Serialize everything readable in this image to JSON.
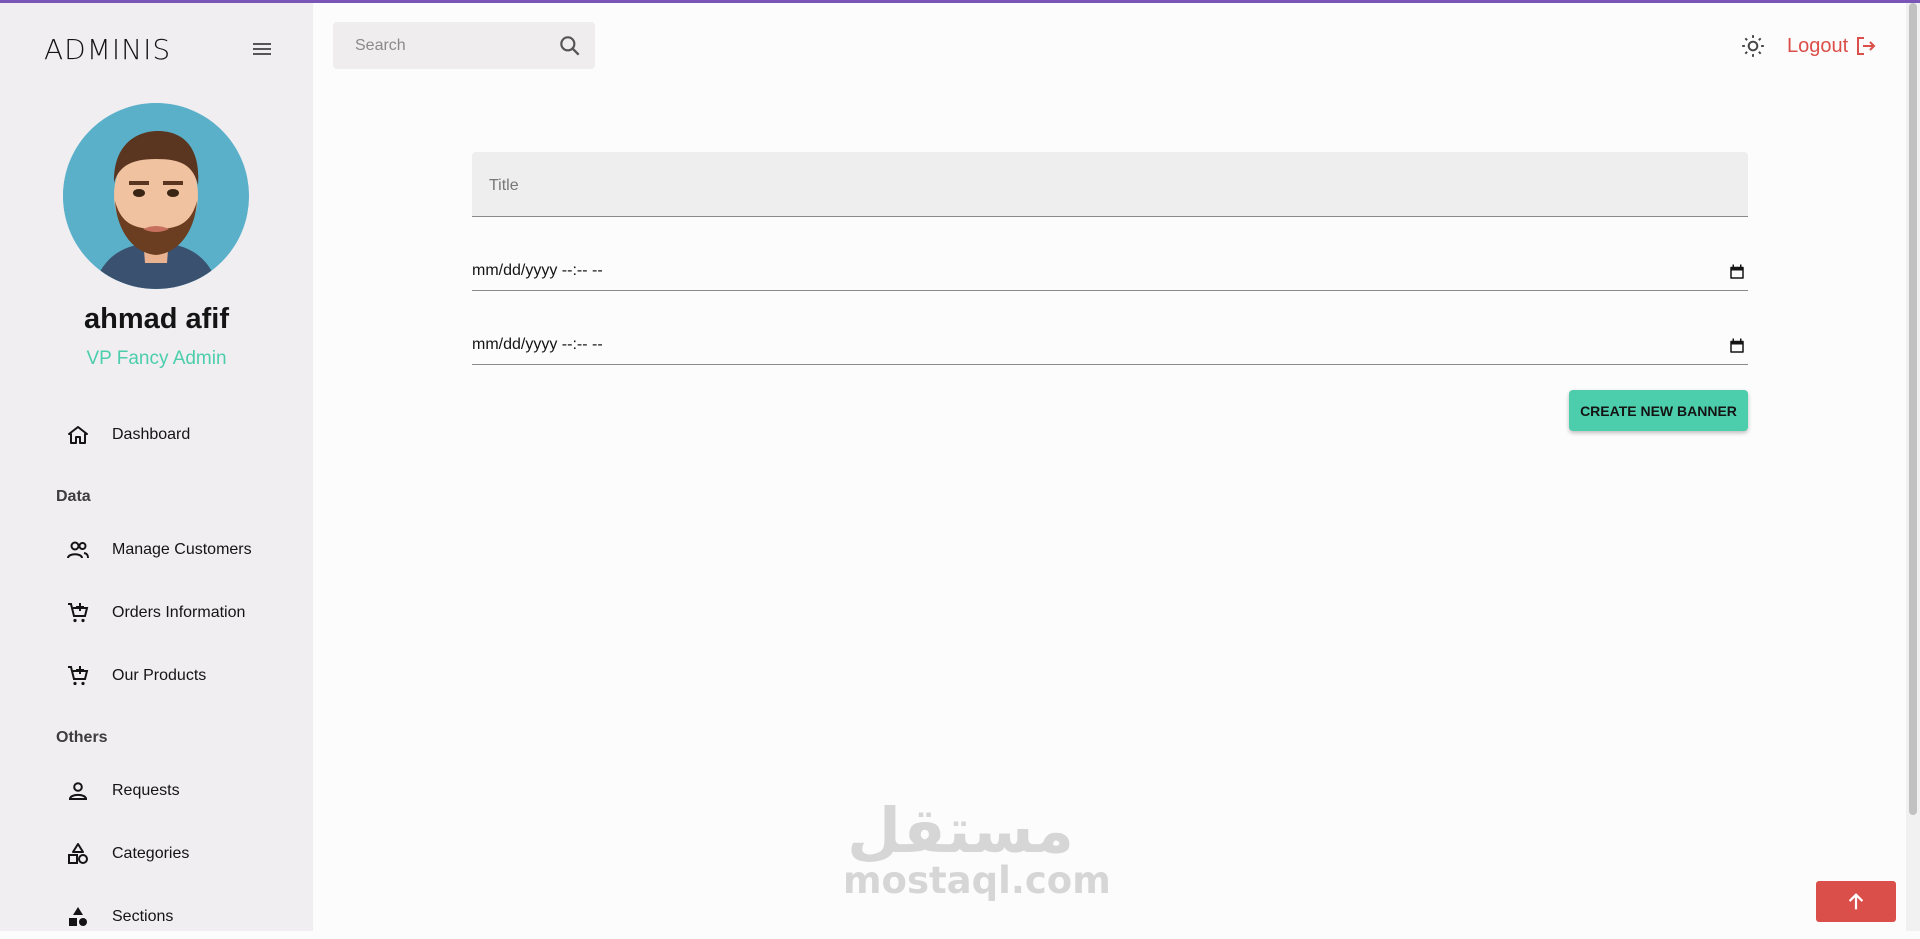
{
  "app": {
    "brand": "ADMINIS"
  },
  "user": {
    "name": "ahmad afif",
    "role": "VP Fancy Admin"
  },
  "sidebar": {
    "items": [
      {
        "label": "Dashboard",
        "icon": "home-icon"
      },
      {
        "label": "Manage Customers",
        "icon": "people-icon"
      },
      {
        "label": "Orders Information",
        "icon": "cart-icon"
      },
      {
        "label": "Our Products",
        "icon": "cart-icon"
      },
      {
        "label": "Requests",
        "icon": "person-icon"
      },
      {
        "label": "Categories",
        "icon": "category-icon"
      },
      {
        "label": "Sections",
        "icon": "shapes-icon"
      }
    ],
    "sections": {
      "data": "Data",
      "others": "Others"
    }
  },
  "topbar": {
    "search_placeholder": "Search",
    "logout_label": "Logout"
  },
  "form": {
    "title_placeholder": "Title",
    "start_date_value": "mm/dd/yyyy --:-- --",
    "end_date_value": "mm/dd/yyyy --:-- --",
    "submit_label": "CREATE NEW BANNER"
  },
  "watermark": {
    "arabic": "مستقل",
    "latin": "mostaql.com"
  },
  "colors": {
    "accent": "#4cceac",
    "danger": "#db4f4a",
    "sidebar_bg": "#f0eef1",
    "top_line": "#7a56b8"
  }
}
